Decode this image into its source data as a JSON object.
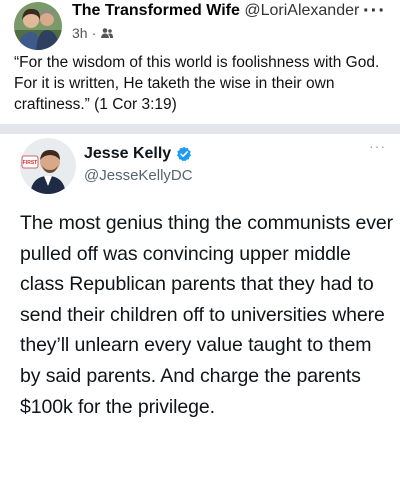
{
  "outer_post": {
    "author_name": "The Transformed Wife",
    "author_handle": "@LoriAlexander",
    "time": "3h",
    "separator": "·",
    "more_label": "···",
    "audience_icon": "friends-icon",
    "text": "“For the wisdom of this world is foolishness with God. For it is written, He taketh the wise in their own craftiness.” (1 Cor 3:19)"
  },
  "tweet": {
    "author_name": "Jesse Kelly",
    "author_handle": "@JesseKellyDC",
    "verified_icon": "verified-badge-icon",
    "more_label": "···",
    "avatar_badge_text": "FIRST",
    "text": "The most genius thing the communists ever pulled off was convincing upper middle class Republican parents that they had to send their children off to universities where they’ll unlearn every value taught to them by said parents. And charge the parents $100k for the privilege."
  },
  "colors": {
    "divider": "#e4e6eb",
    "verified": "#1d9bf0",
    "handle": "#536471"
  }
}
